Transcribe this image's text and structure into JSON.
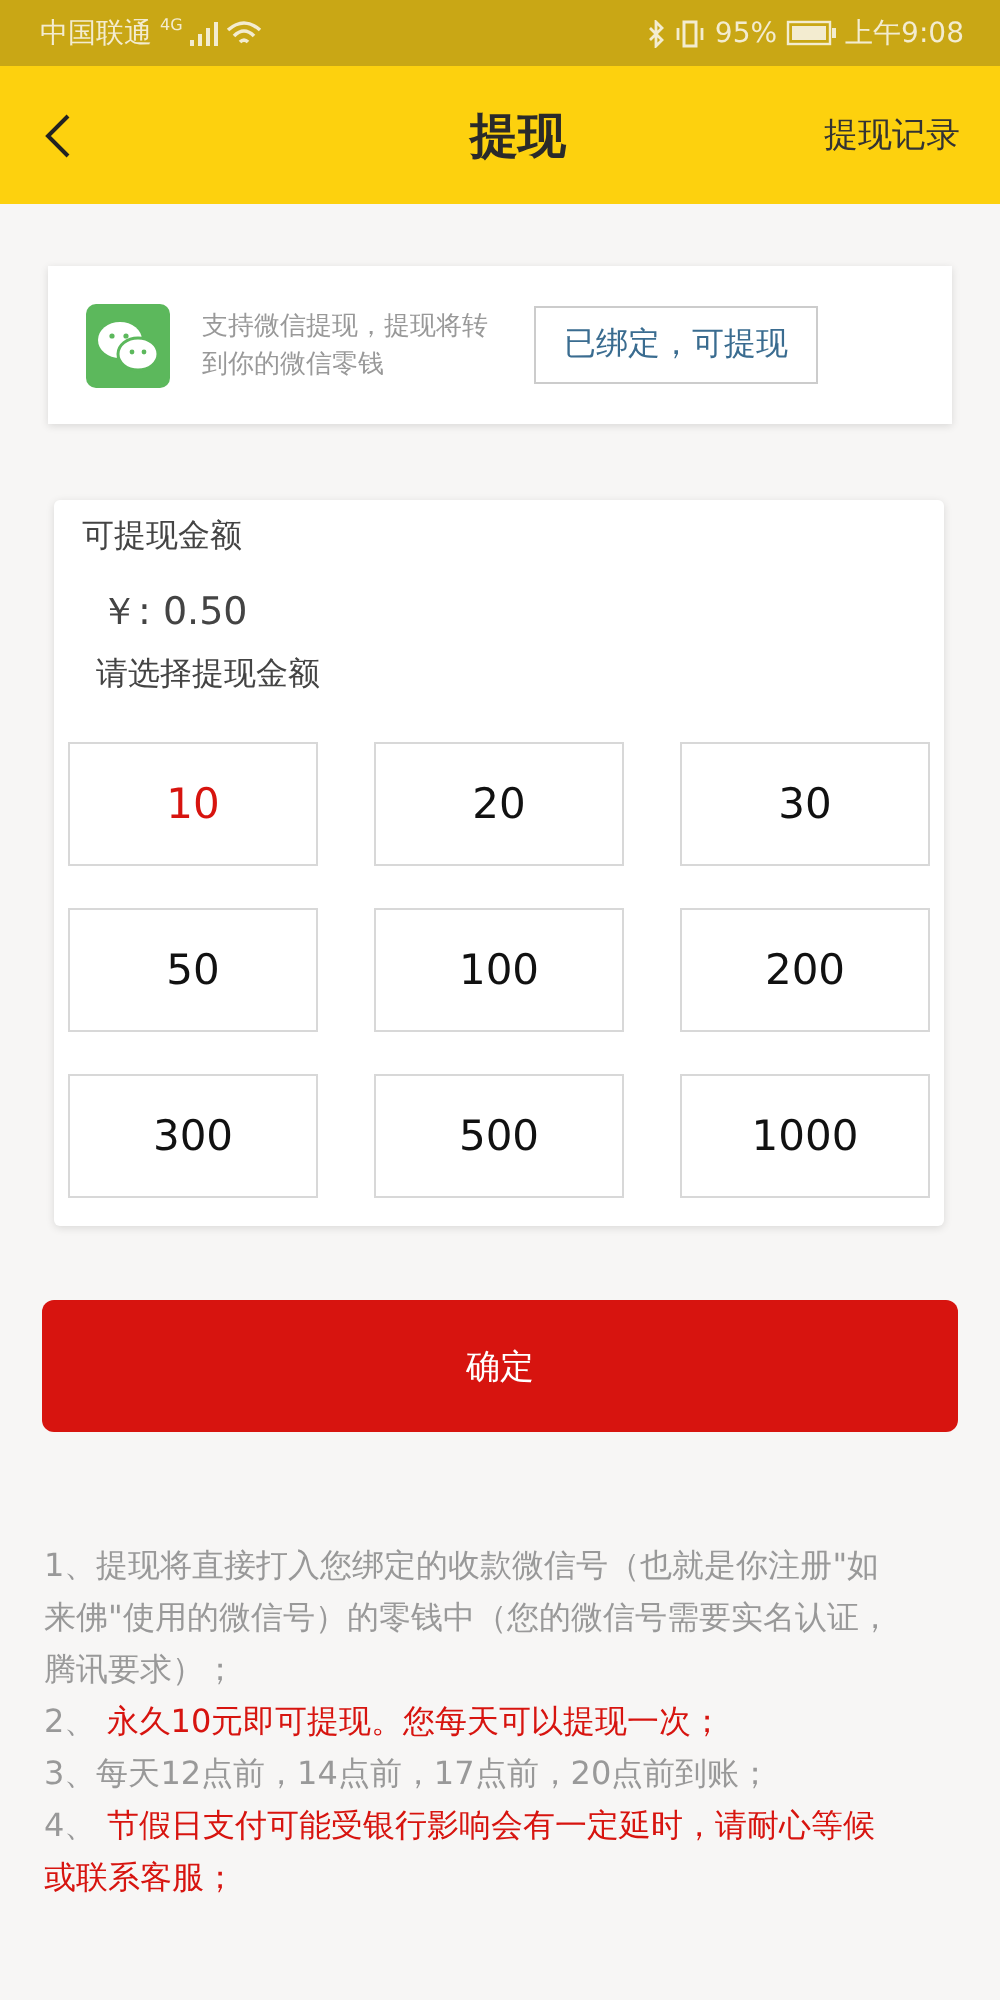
{
  "status_bar": {
    "carrier": "中国联通",
    "network": "4G",
    "battery": "95%",
    "time": "上午9:08"
  },
  "header": {
    "title": "提现",
    "action": "提现记录"
  },
  "wechat_card": {
    "text": "支持微信提现，提现将转到你的微信零钱",
    "status": "已绑定，可提现"
  },
  "amount_card": {
    "label": "可提现金额",
    "balance": "￥: 0.50",
    "prompt": "请选择提现金额",
    "options": [
      {
        "label": "10",
        "selected": true
      },
      {
        "label": "20",
        "selected": false
      },
      {
        "label": "30",
        "selected": false
      },
      {
        "label": "50",
        "selected": false
      },
      {
        "label": "100",
        "selected": false
      },
      {
        "label": "200",
        "selected": false
      },
      {
        "label": "300",
        "selected": false
      },
      {
        "label": "500",
        "selected": false
      },
      {
        "label": "1000",
        "selected": false
      }
    ]
  },
  "confirm_button": "确定",
  "notes": [
    {
      "number": "1、",
      "text": "提现将直接打入您绑定的收款微信号（也就是你注册\"如来佛\"使用的微信号）的零钱中（您的微信号需要实名认证，腾讯要求）；",
      "highlight": false
    },
    {
      "number": "2、",
      "text": " 永久10元即可提现。您每天可以提现一次；",
      "highlight": true
    },
    {
      "number": "3、",
      "text": "每天12点前，14点前，17点前，20点前到账；",
      "highlight": false
    },
    {
      "number": "4、",
      "text": " 节假日支付可能受银行影响会有一定延时，请耐心等候或联系客服；",
      "highlight": true
    }
  ]
}
